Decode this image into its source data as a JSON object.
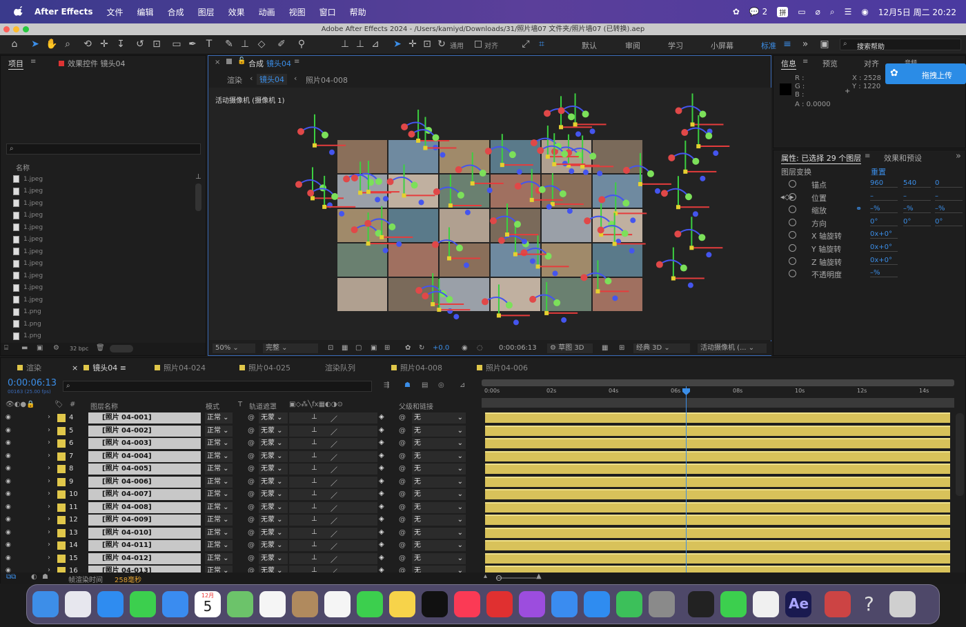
{
  "menubar": {
    "app": "After Effects",
    "items": [
      "文件",
      "编辑",
      "合成",
      "图层",
      "效果",
      "动画",
      "视图",
      "窗口",
      "帮助"
    ],
    "wechat_count": "2",
    "ime": "拼",
    "datetime": "12月5日 周二 20:22"
  },
  "window": {
    "title": "Adobe After Effects 2024 - /Users/kamiyd/Downloads/31/照片墙07 文件夹/照片墙07 (已转换).aep"
  },
  "toolbar": {
    "universal": "通用",
    "snap": "对齐",
    "workspaces": [
      "默认",
      "审阅",
      "学习",
      "小屏幕",
      "标准"
    ],
    "search_placeholder": "搜索帮助"
  },
  "project": {
    "tab": "项目",
    "effects_tab": "效果控件 镜头04",
    "col_name": "名称",
    "items": [
      "1.jpeg",
      "1.jpeg",
      "1.jpeg",
      "1.jpeg",
      "1.jpeg",
      "1.jpeg",
      "1.jpeg",
      "1.jpeg",
      "1.jpeg",
      "1.jpeg",
      "1.jpeg",
      "1.png",
      "1.png",
      "1.png"
    ],
    "bpc": "32 bpc"
  },
  "comp": {
    "tab_prefix": "合成",
    "tab_name": "镜头04",
    "crumbs": [
      "渲染",
      "镜头04",
      "照片04-008"
    ],
    "camera_label": "活动摄像机 (摄像机 1)",
    "zoom": "50%",
    "quality": "完整",
    "exposure": "+0.0",
    "time": "0:00:06:13",
    "draft3d": "草图 3D",
    "renderer": "经典 3D",
    "camera_sel": "活动摄像机 (..."
  },
  "info": {
    "tabs": [
      "信息",
      "预览",
      "对齐",
      "音频"
    ],
    "r": "R :",
    "g": "G :",
    "b": "B :",
    "a": "A :  0.0000",
    "x": "X : 2528",
    "y": "Y : 1220",
    "upload": "拖拽上传"
  },
  "props": {
    "header": "属性: 已选择 29 个图层",
    "effects_tab": "效果和预设",
    "group": "图层变换",
    "reset": "重置",
    "rows": [
      {
        "name": "锚点",
        "v": [
          "960",
          "540",
          "0"
        ]
      },
      {
        "name": "位置",
        "v": [
          "–",
          "–",
          "–"
        ]
      },
      {
        "name": "缩放",
        "v": [
          "–%",
          "–%",
          "–%"
        ]
      },
      {
        "name": "方向",
        "v": [
          "0°",
          "0°",
          "0°"
        ]
      },
      {
        "name": "X 轴旋转",
        "v": [
          "0x+0°"
        ]
      },
      {
        "name": "Y 轴旋转",
        "v": [
          "0x+0°"
        ]
      },
      {
        "name": "Z 轴旋转",
        "v": [
          "0x+0°"
        ]
      },
      {
        "name": "不透明度",
        "v": [
          "–%"
        ]
      }
    ]
  },
  "timeline": {
    "tabs": [
      "渲染",
      "镜头04",
      "照片04-024",
      "照片04-025",
      "渲染队列",
      "照片04-008",
      "照片04-006"
    ],
    "time": "0:00:06:13",
    "fps": "00163 (25.00 fps)",
    "cols": {
      "layer": "图层名称",
      "mode": "模式",
      "t": "T",
      "track": "轨道遮罩",
      "parent": "父级和链接"
    },
    "ruler": [
      "0:00s",
      "02s",
      "04s",
      "06s",
      "08s",
      "10s",
      "12s",
      "14s"
    ],
    "layers": [
      {
        "n": "4",
        "name": "[照片 04-001]"
      },
      {
        "n": "5",
        "name": "[照片 04-002]"
      },
      {
        "n": "6",
        "name": "[照片 04-003]"
      },
      {
        "n": "7",
        "name": "[照片 04-004]"
      },
      {
        "n": "8",
        "name": "[照片 04-005]"
      },
      {
        "n": "9",
        "name": "[照片 04-006]"
      },
      {
        "n": "10",
        "name": "[照片 04-007]"
      },
      {
        "n": "11",
        "name": "[照片 04-008]"
      },
      {
        "n": "12",
        "name": "[照片 04-009]"
      },
      {
        "n": "13",
        "name": "[照片 04-010]"
      },
      {
        "n": "14",
        "name": "[照片 04-011]"
      },
      {
        "n": "15",
        "name": "[照片 04-012]"
      },
      {
        "n": "16",
        "name": "[照片 04-013]"
      }
    ],
    "mode_val": "正常",
    "track_val": "无蒙",
    "parent_val": "无",
    "render_time_label": "帧渲染时间",
    "render_time": "258毫秒"
  },
  "dock": {
    "calendar_month": "12月",
    "calendar_day": "5",
    "apps": [
      "finder",
      "launchpad",
      "safari",
      "messages",
      "mail",
      "maps",
      "photos",
      "contacts",
      "reminders",
      "facetime",
      "notes",
      "appletv",
      "music",
      "netease",
      "podcasts",
      "keynote",
      "appstore",
      "numbers",
      "settings",
      "davinci",
      "wechat",
      "baidunetdisk",
      "aftereffects",
      "archive",
      "help",
      "trash"
    ]
  }
}
